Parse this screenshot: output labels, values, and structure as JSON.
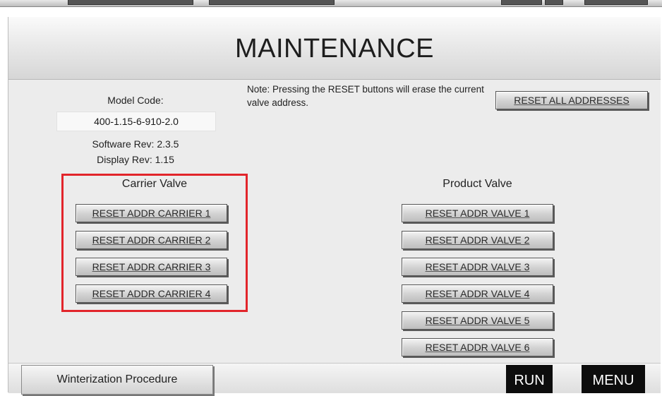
{
  "title": "MAINTENANCE",
  "model": {
    "label": "Model Code:",
    "value": "400-1.15-6-910-2.0",
    "software_rev": "Software Rev:  2.3.5",
    "display_rev": "Display Rev: 1.15"
  },
  "note": "Note: Pressing the RESET buttons will erase the current valve address.",
  "reset_all_label": "RESET ALL ADDRESSES",
  "carrier": {
    "title": "Carrier Valve",
    "buttons": [
      "RESET ADDR CARRIER 1",
      "RESET ADDR CARRIER 2",
      "RESET ADDR CARRIER 3",
      "RESET ADDR CARRIER 4"
    ]
  },
  "product": {
    "title": "Product Valve",
    "buttons": [
      "RESET ADDR VALVE 1",
      "RESET ADDR VALVE 2",
      "RESET ADDR VALVE 3",
      "RESET ADDR VALVE 4",
      "RESET ADDR VALVE 5",
      "RESET ADDR VALVE 6"
    ]
  },
  "footer": {
    "winterization_label": "Winterization Procedure",
    "run_label": "RUN",
    "menu_label": "MENU"
  },
  "colors": {
    "highlight_border": "#e2252b",
    "dark_button": "#0d0d0d"
  }
}
